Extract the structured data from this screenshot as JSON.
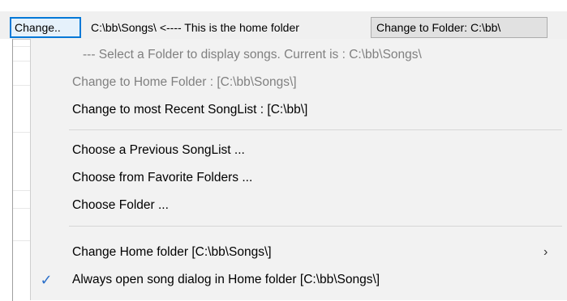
{
  "toolbar": {
    "change_button": "Change..",
    "path_label": "C:\\bb\\Songs\\  <---- This is the home folder",
    "change_to_button": "Change to Folder: C:\\bb\\"
  },
  "menu": {
    "header": "--- Select a Folder to display songs. Current is : C:\\bb\\Songs\\",
    "change_to_home": "Change to Home Folder : [C:\\bb\\Songs\\]",
    "change_to_recent": "Change to most Recent SongList : [C:\\bb\\]",
    "choose_previous": "Choose a Previous SongList ...",
    "choose_favorite": "Choose from Favorite Folders ...",
    "choose_folder": "Choose Folder ...",
    "change_home": "Change Home folder [C:\\bb\\Songs\\]",
    "always_open": "Always open song dialog in Home folder  [C:\\bb\\Songs\\]",
    "submenu_icon": "chevron-right-icon",
    "check_icon": "checkmark-icon"
  }
}
